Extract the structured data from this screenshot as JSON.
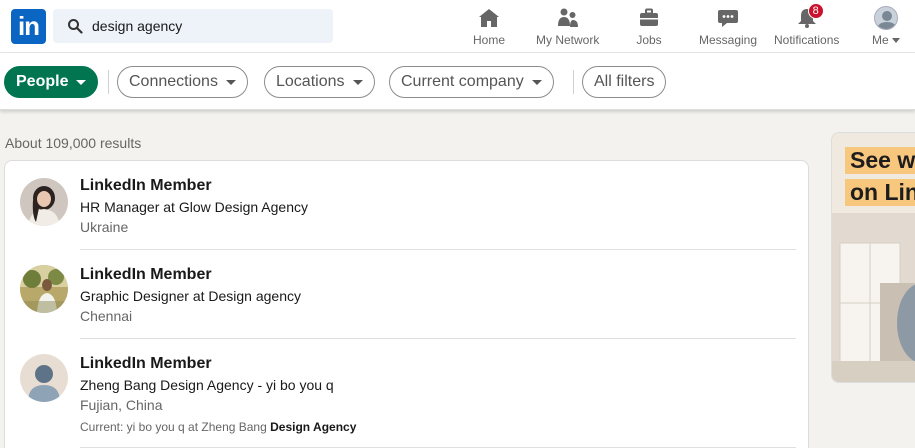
{
  "header": {
    "logo_text": "in",
    "search": {
      "value": "design agency",
      "placeholder": "Search"
    },
    "nav": [
      {
        "label": "Home",
        "icon": "home-icon"
      },
      {
        "label": "My Network",
        "icon": "network-icon"
      },
      {
        "label": "Jobs",
        "icon": "briefcase-icon"
      },
      {
        "label": "Messaging",
        "icon": "messaging-icon"
      },
      {
        "label": "Notifications",
        "icon": "bell-icon",
        "badge": "8"
      },
      {
        "label": "Me",
        "icon": "avatar"
      }
    ]
  },
  "filters": {
    "people": "People",
    "connections": "Connections",
    "locations": "Locations",
    "current_company": "Current company",
    "all_filters": "All filters"
  },
  "results": {
    "count_text": "About 109,000 results",
    "items": [
      {
        "name": "LinkedIn Member",
        "title": "HR Manager at Glow Design Agency",
        "location": "Ukraine"
      },
      {
        "name": "LinkedIn Member",
        "title": "Graphic Designer at Design agency",
        "location": "Chennai"
      },
      {
        "name": "LinkedIn Member",
        "title": "Zheng Bang Design Agency - yi bo you q",
        "location": "Fujian, China",
        "current_prefix": "Current: yi bo you q at Zheng Bang",
        "current_highlight": "Design Agency"
      }
    ]
  },
  "ad": {
    "line1": "See w",
    "line2": "on Lin"
  },
  "colors": {
    "brand": "#0a66c2",
    "active_filter": "#01754f",
    "badge": "#cb112d"
  }
}
